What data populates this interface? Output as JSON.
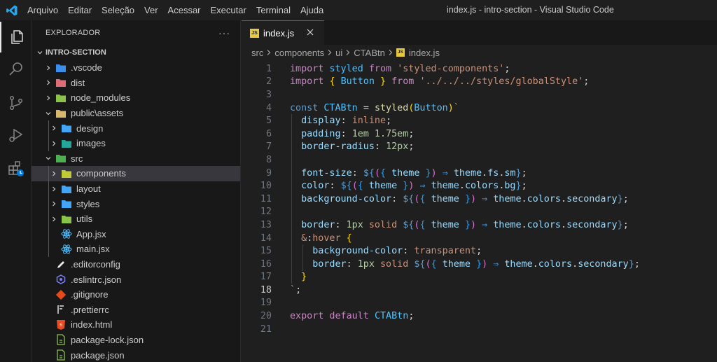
{
  "app": {
    "menu": [
      "Arquivo",
      "Editar",
      "Seleção",
      "Ver",
      "Acessar",
      "Executar",
      "Terminal",
      "Ajuda"
    ],
    "window_title": "index.js - intro-section - Visual Studio Code",
    "brand_color": "#007acc"
  },
  "activity_bar": {
    "icons": [
      "explorer-icon",
      "search-icon",
      "source-control-icon",
      "run-debug-icon",
      "extensions-icon"
    ]
  },
  "sidebar": {
    "title": "EXPLORADOR",
    "more": "···",
    "section": "INTRO-SECTION",
    "items": [
      {
        "label": ".vscode",
        "icon": "vscode-folder-icon",
        "color": "#3b8eea",
        "chevron": "›"
      },
      {
        "label": "dist",
        "icon": "dist-folder-icon",
        "color": "#e06c75",
        "chevron": "›"
      },
      {
        "label": "node_modules",
        "icon": "node-folder-icon",
        "color": "#8bc34a",
        "chevron": "›"
      },
      {
        "label": "public\\assets",
        "icon": "public-folder-icon",
        "color": "#d7b86c",
        "chevron": "⌄"
      },
      {
        "label": "design",
        "icon": "design-folder-icon",
        "color": "#42a5f5",
        "chevron": "›"
      },
      {
        "label": "images",
        "icon": "images-folder-icon",
        "color": "#26a69a",
        "chevron": "›"
      },
      {
        "label": "src",
        "icon": "src-folder-icon",
        "color": "#4caf50",
        "chevron": "⌄"
      },
      {
        "label": "components",
        "icon": "components-folder-icon",
        "color": "#c0ca33",
        "chevron": "›"
      },
      {
        "label": "layout",
        "icon": "layout-folder-icon",
        "color": "#42a5f5",
        "chevron": "›"
      },
      {
        "label": "styles",
        "icon": "styles-folder-icon",
        "color": "#42a5f5",
        "chevron": "›"
      },
      {
        "label": "utils",
        "icon": "utils-folder-icon",
        "color": "#8bc34a",
        "chevron": "›"
      },
      {
        "label": "App.jsx",
        "icon": "react-icon",
        "color": "#4fc1ff",
        "chevron": ""
      },
      {
        "label": "main.jsx",
        "icon": "react-icon",
        "color": "#4fc1ff",
        "chevron": ""
      },
      {
        "label": ".editorconfig",
        "icon": "editorconfig-icon",
        "color": "#e8e8e8",
        "chevron": ""
      },
      {
        "label": ".eslintrc.json",
        "icon": "eslint-icon",
        "color": "#7c7cf8",
        "chevron": ""
      },
      {
        "label": ".gitignore",
        "icon": "git-icon",
        "color": "#e64a19",
        "chevron": ""
      },
      {
        "label": ".prettierrc",
        "icon": "prettier-icon",
        "color": "#b0b0b0",
        "chevron": ""
      },
      {
        "label": "index.html",
        "icon": "html-icon",
        "color": "#e44d26",
        "chevron": ""
      },
      {
        "label": "package-lock.json",
        "icon": "npm-lock-icon",
        "color": "#8bc34a",
        "chevron": ""
      },
      {
        "label": "package.json",
        "icon": "npm-icon",
        "color": "#8bc34a",
        "chevron": ""
      }
    ]
  },
  "editor": {
    "tab": {
      "label": "index.js",
      "icon_text": "JS",
      "close": "✕"
    },
    "breadcrumb": [
      "src",
      "components",
      "ui",
      "CTABtn"
    ],
    "breadcrumb_file": "index.js",
    "lines": [
      [
        [
          "kw",
          "import "
        ],
        [
          "var",
          "styled "
        ],
        [
          "kw",
          "from "
        ],
        [
          "str",
          "'styled-components'"
        ],
        [
          "op",
          ";"
        ]
      ],
      [
        [
          "kw",
          "import "
        ],
        [
          "b1",
          "{ "
        ],
        [
          "var",
          "Button "
        ],
        [
          "b1",
          "} "
        ],
        [
          "kw",
          "from "
        ],
        [
          "str",
          "'../../../styles/globalStyle'"
        ],
        [
          "op",
          ";"
        ]
      ],
      [],
      [
        [
          "tpl",
          "const "
        ],
        [
          "var",
          "CTABtn "
        ],
        [
          "op",
          "= "
        ],
        [
          "fn",
          "styled"
        ],
        [
          "b1",
          "("
        ],
        [
          "var",
          "Button"
        ],
        [
          "b1",
          ")"
        ],
        [
          "str",
          "`"
        ]
      ],
      [
        [
          "op",
          "  "
        ],
        [
          "prop",
          "display"
        ],
        [
          "op",
          ": "
        ],
        [
          "val",
          "inline"
        ],
        [
          "op",
          ";"
        ]
      ],
      [
        [
          "op",
          "  "
        ],
        [
          "prop",
          "padding"
        ],
        [
          "op",
          ": "
        ],
        [
          "num",
          "1em 1.75em"
        ],
        [
          "op",
          ";"
        ]
      ],
      [
        [
          "op",
          "  "
        ],
        [
          "prop",
          "border-radius"
        ],
        [
          "op",
          ": "
        ],
        [
          "num",
          "12px"
        ],
        [
          "op",
          ";"
        ]
      ],
      [],
      [
        [
          "op",
          "  "
        ],
        [
          "prop",
          "font-size"
        ],
        [
          "op",
          ": "
        ],
        [
          "tpl",
          "${"
        ],
        [
          "b2",
          "("
        ],
        [
          "b3",
          "{ "
        ],
        [
          "id",
          "theme "
        ],
        [
          "b3",
          "}"
        ],
        [
          "b2",
          ") "
        ],
        [
          "tpl",
          "⇒ "
        ],
        [
          "id",
          "theme"
        ],
        [
          "op",
          "."
        ],
        [
          "id",
          "fs"
        ],
        [
          "op",
          "."
        ],
        [
          "id",
          "sm"
        ],
        [
          "tpl",
          "}"
        ],
        [
          "op",
          ";"
        ]
      ],
      [
        [
          "op",
          "  "
        ],
        [
          "prop",
          "color"
        ],
        [
          "op",
          ": "
        ],
        [
          "tpl",
          "${"
        ],
        [
          "b2",
          "("
        ],
        [
          "b3",
          "{ "
        ],
        [
          "id",
          "theme "
        ],
        [
          "b3",
          "}"
        ],
        [
          "b2",
          ") "
        ],
        [
          "tpl",
          "⇒ "
        ],
        [
          "id",
          "theme"
        ],
        [
          "op",
          "."
        ],
        [
          "id",
          "colors"
        ],
        [
          "op",
          "."
        ],
        [
          "id",
          "bg"
        ],
        [
          "tpl",
          "}"
        ],
        [
          "op",
          ";"
        ]
      ],
      [
        [
          "op",
          "  "
        ],
        [
          "prop",
          "background-color"
        ],
        [
          "op",
          ": "
        ],
        [
          "tpl",
          "${"
        ],
        [
          "b2",
          "("
        ],
        [
          "b3",
          "{ "
        ],
        [
          "id",
          "theme "
        ],
        [
          "b3",
          "}"
        ],
        [
          "b2",
          ") "
        ],
        [
          "tpl",
          "⇒ "
        ],
        [
          "id",
          "theme"
        ],
        [
          "op",
          "."
        ],
        [
          "id",
          "colors"
        ],
        [
          "op",
          "."
        ],
        [
          "id",
          "secondary"
        ],
        [
          "tpl",
          "}"
        ],
        [
          "op",
          ";"
        ]
      ],
      [],
      [
        [
          "op",
          "  "
        ],
        [
          "prop",
          "border"
        ],
        [
          "op",
          ": "
        ],
        [
          "num",
          "1px "
        ],
        [
          "val",
          "solid "
        ],
        [
          "tpl",
          "${"
        ],
        [
          "b2",
          "("
        ],
        [
          "b3",
          "{ "
        ],
        [
          "id",
          "theme "
        ],
        [
          "b3",
          "}"
        ],
        [
          "b2",
          ") "
        ],
        [
          "tpl",
          "⇒ "
        ],
        [
          "id",
          "theme"
        ],
        [
          "op",
          "."
        ],
        [
          "id",
          "colors"
        ],
        [
          "op",
          "."
        ],
        [
          "id",
          "secondary"
        ],
        [
          "tpl",
          "}"
        ],
        [
          "op",
          ";"
        ]
      ],
      [
        [
          "op",
          "  "
        ],
        [
          "val",
          "&"
        ],
        [
          "op",
          ":"
        ],
        [
          "val",
          "hover "
        ],
        [
          "b1",
          "{"
        ]
      ],
      [
        [
          "op",
          "    "
        ],
        [
          "prop",
          "background-color"
        ],
        [
          "op",
          ": "
        ],
        [
          "val",
          "transparent"
        ],
        [
          "op",
          ";"
        ]
      ],
      [
        [
          "op",
          "    "
        ],
        [
          "prop",
          "border"
        ],
        [
          "op",
          ": "
        ],
        [
          "num",
          "1px "
        ],
        [
          "val",
          "solid "
        ],
        [
          "tpl",
          "${"
        ],
        [
          "b2",
          "("
        ],
        [
          "b3",
          "{ "
        ],
        [
          "id",
          "theme "
        ],
        [
          "b3",
          "}"
        ],
        [
          "b2",
          ") "
        ],
        [
          "tpl",
          "⇒ "
        ],
        [
          "id",
          "theme"
        ],
        [
          "op",
          "."
        ],
        [
          "id",
          "colors"
        ],
        [
          "op",
          "."
        ],
        [
          "id",
          "secondary"
        ],
        [
          "tpl",
          "}"
        ],
        [
          "op",
          ";"
        ]
      ],
      [
        [
          "op",
          "  "
        ],
        [
          "b1",
          "}"
        ]
      ],
      [
        [
          "str",
          "`"
        ],
        [
          "op",
          ";"
        ]
      ],
      [],
      [
        [
          "kw",
          "export default "
        ],
        [
          "var",
          "CTABtn"
        ],
        [
          "op",
          ";"
        ]
      ],
      []
    ],
    "current_line": 18
  }
}
